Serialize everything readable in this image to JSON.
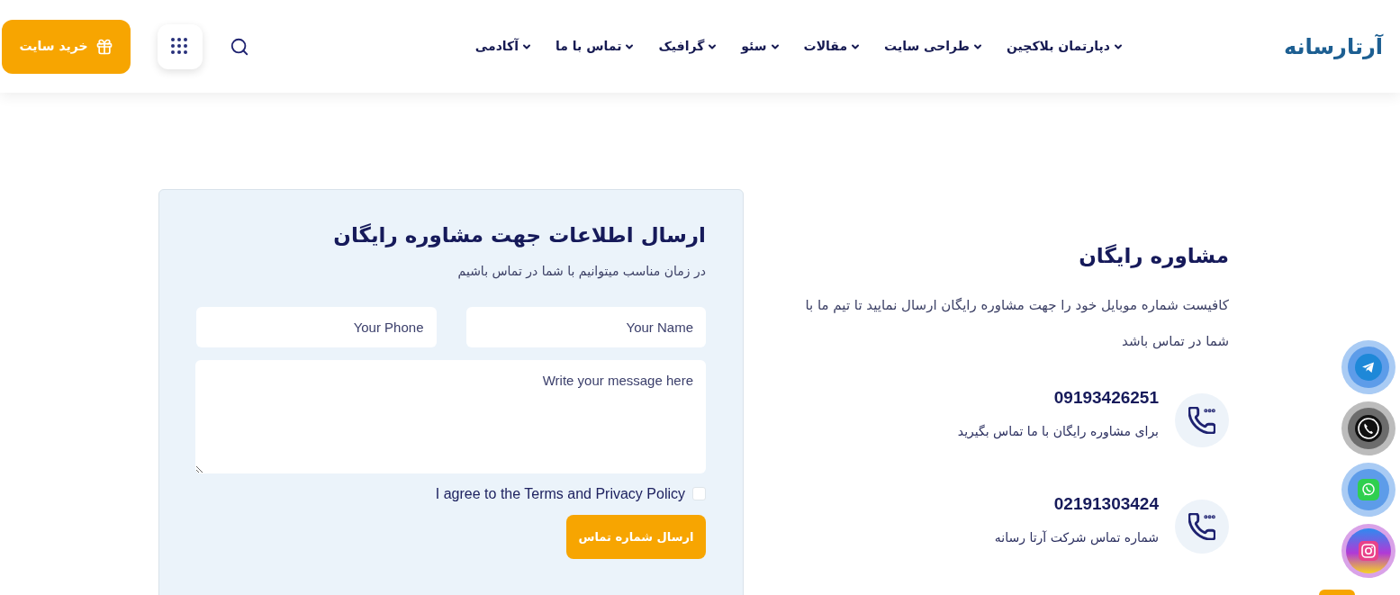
{
  "header": {
    "logo": "آرتارسانه",
    "nav": [
      {
        "label": "دپارتمان بلاکچین",
        "dropdown": true
      },
      {
        "label": "طراحی سایت",
        "dropdown": true
      },
      {
        "label": "مقالات",
        "dropdown": true
      },
      {
        "label": "سئو",
        "dropdown": true
      },
      {
        "label": "گرافیک",
        "dropdown": true
      },
      {
        "label": "تماس با ما",
        "dropdown": true
      },
      {
        "label": "آکادمی",
        "dropdown": true
      }
    ],
    "buy_button": "خرید سایت"
  },
  "form": {
    "title": "ارسال اطلاعات جهت مشاوره رایگان",
    "subtitle": "در زمان مناسب میتوانیم با شما در تماس باشیم",
    "fields": [
      {
        "placeholder": "Your Name"
      },
      {
        "placeholder": "Your Phone"
      }
    ],
    "message": {
      "placeholder": "Write your message here"
    },
    "consent": {
      "label": "I agree to the Terms and Privacy Policy",
      "checked": false
    },
    "submit": "ارسال شماره تماس"
  },
  "info": {
    "title": "مشاوره رایگان",
    "text": "کافیست شماره موبایل خود را جهت مشاوره رایگان ارسال نمایید تا تیم ما با شما در تماس باشد",
    "contacts": [
      {
        "number": "09193426251",
        "caption": "برای مشاوره رایگان با ما تماس بگیرید"
      },
      {
        "number": "02191303424",
        "caption": "شماره تماس شرکت آرتا رسانه"
      }
    ]
  }
}
